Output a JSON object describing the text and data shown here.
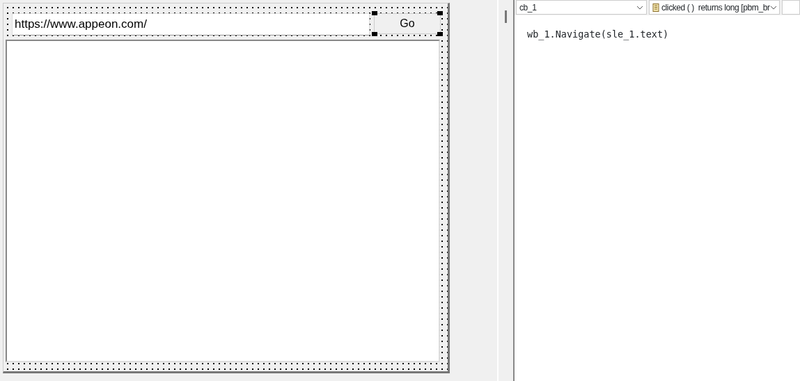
{
  "window_design": {
    "url_field": {
      "value": "https://www.appeon.com/"
    },
    "go_button": {
      "label": "Go",
      "selected": true
    }
  },
  "script_editor": {
    "object_dropdown": {
      "value": "cb_1"
    },
    "event_dropdown": {
      "value": "clicked ( )  returns long [pbm_br"
    },
    "code_lines": [
      "wb_1.Navigate(sle_1.text)"
    ]
  }
}
